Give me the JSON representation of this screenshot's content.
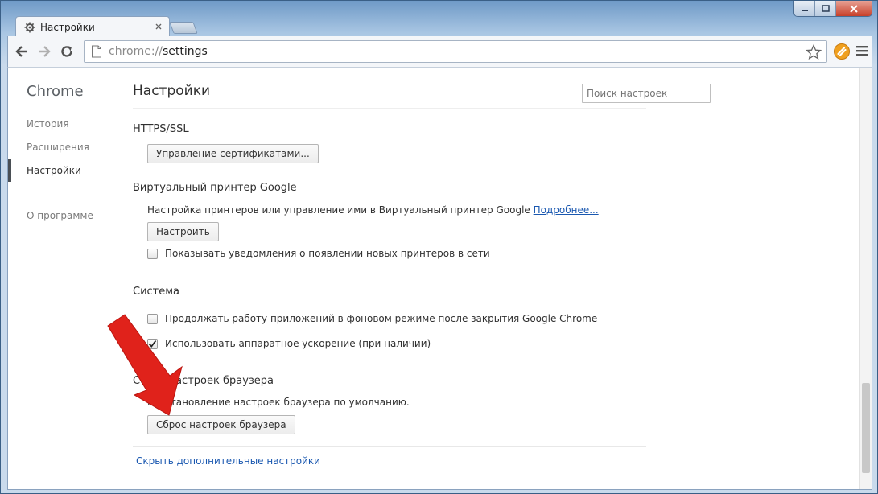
{
  "window": {
    "tab_title": "Настройки"
  },
  "toolbar": {
    "url_scheme": "chrome://",
    "url_host": "settings"
  },
  "sidebar": {
    "title": "Chrome",
    "items": [
      {
        "label": "История"
      },
      {
        "label": "Расширения"
      },
      {
        "label": "Настройки"
      },
      {
        "label": "О программе"
      }
    ],
    "selected": "Настройки"
  },
  "main": {
    "page_title": "Настройки",
    "search_placeholder": "Поиск настроек",
    "https": {
      "heading": "HTTPS/SSL",
      "button": "Управление сертификатами..."
    },
    "cloud_print": {
      "heading": "Виртуальный принтер Google",
      "description": "Настройка принтеров или управление ими в Виртуальный принтер Google",
      "learn_more": "Подробнее...",
      "button": "Настроить",
      "checkbox_label": "Показывать уведомления о появлении новых принтеров в сети",
      "checkbox_checked": false
    },
    "system": {
      "heading": "Система",
      "bg_apps_label": "Продолжать работу приложений в фоновом режиме после закрытия Google Chrome",
      "bg_apps_checked": false,
      "hw_accel_label": "Использовать аппаратное ускорение (при наличии)",
      "hw_accel_checked": true
    },
    "reset": {
      "heading": "Сброс настроек браузера",
      "description": "Восстановление настроек браузера по умолчанию.",
      "button": "Сброс настроек браузера"
    },
    "hide_advanced": "Скрыть дополнительные настройки"
  },
  "colors": {
    "link": "#1a58b0",
    "arrow": "#e0221b"
  }
}
